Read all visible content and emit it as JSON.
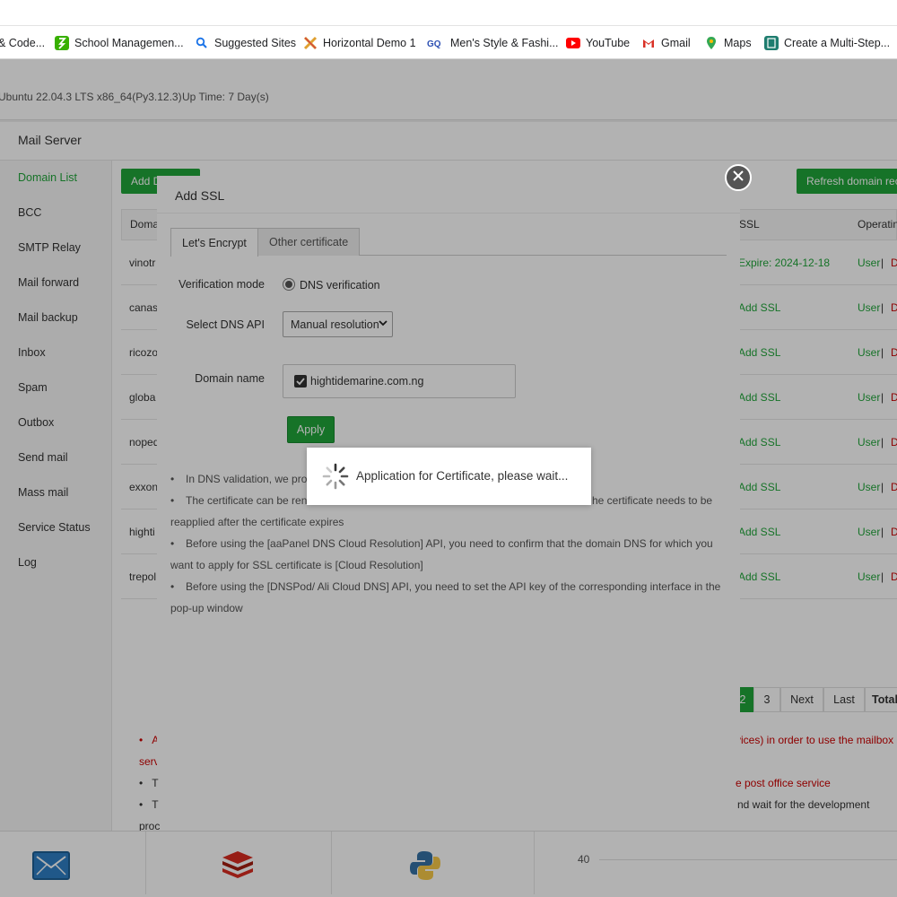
{
  "bookmarks": [
    {
      "label": "& Code...",
      "icon": "code-icon"
    },
    {
      "label": "School Managemen...",
      "icon": "school-icon"
    },
    {
      "label": "Suggested Sites",
      "icon": "search-icon"
    },
    {
      "label": "Horizontal Demo 1",
      "icon": "horizontal-demo-icon"
    },
    {
      "label": "Men's Style & Fashi...",
      "icon": "gq-icon"
    },
    {
      "label": "YouTube",
      "icon": "youtube-icon"
    },
    {
      "label": "Gmail",
      "icon": "gmail-icon"
    },
    {
      "label": "Maps",
      "icon": "maps-icon"
    },
    {
      "label": "Create a Multi-Step...",
      "icon": "page-icon"
    }
  ],
  "sysinfo": {
    "os": "Ubuntu 22.04.3 LTS x86_64(Py3.12.3)",
    "uptime": "Up Time: 7 Day(s)"
  },
  "panel": {
    "title": "Mail Server",
    "add_domain": "Add D",
    "refresh": "Refresh domain rec"
  },
  "sidebar": {
    "items": [
      "Domain List",
      "BCC",
      "SMTP Relay",
      "Mail forward",
      "Mail backup",
      "Inbox",
      "Spam",
      "Outbox",
      "Send mail",
      "Mass mail",
      "Service Status",
      "Log"
    ]
  },
  "table": {
    "headers": {
      "domain": "Doma",
      "ssl": "SSL",
      "ops": "Operatin"
    },
    "rows": [
      {
        "domain": "vinotr",
        "ssl": "Expire: 2024-12-18",
        "user": "User",
        "sep": "|",
        "del": "D"
      },
      {
        "domain": "canas",
        "ssl": "Add SSL",
        "user": "User",
        "sep": "|",
        "del": "D"
      },
      {
        "domain": "ricozo",
        "ssl": "Add SSL",
        "user": "User",
        "sep": "|",
        "del": "D"
      },
      {
        "domain": "globa",
        "ssl": "Add SSL",
        "user": "User",
        "sep": "|",
        "del": "D"
      },
      {
        "domain": "noped",
        "ssl": "Add SSL",
        "user": "User",
        "sep": "|",
        "del": "D"
      },
      {
        "domain": "exxon",
        "ssl": "Add SSL",
        "user": "User",
        "sep": "|",
        "del": "D"
      },
      {
        "domain": "highti",
        "ssl": "Add SSL",
        "user": "User",
        "sep": "|",
        "del": "D"
      },
      {
        "domain": "trepol",
        "ssl": "Add SSL",
        "user": "User",
        "sep": "|",
        "del": "D"
      }
    ]
  },
  "pager": {
    "current": "2",
    "p3": "3",
    "next": "Next",
    "last": "Last",
    "total": "Total"
  },
  "notes": {
    "n1_left": "A",
    "n1_right": "rvices) in order to use the mailbox",
    "n1_wrap": "serv",
    "n2_left": "T",
    "n2_right": "e post office service",
    "n3_left": "T",
    "n3_right": "nd wait for the development",
    "n3_wrap": "proc"
  },
  "chart_tick": "40",
  "modal": {
    "title": "Add SSL",
    "tabs": [
      "Let's Encrypt",
      "Other certificate"
    ],
    "verification_label": "Verification mode",
    "verification_value": "DNS verification",
    "dns_api_label": "Select DNS API",
    "dns_api_value": "Manual resolution",
    "domain_label": "Domain name",
    "domain_value": "hightidemarine.com.ng",
    "apply": "Apply",
    "help": {
      "h1": "In DNS validation, we pro",
      "h2a": "The certificate can be ren",
      "h2b": "he certificate needs to be",
      "h2c": "reapplied after the certificate expires",
      "h3": "Before using the [aaPanel DNS Cloud Resolution] API, you need to confirm that the domain DNS for which you want to apply for SSL certificate is [Cloud Resolution]",
      "h4": "Before using the [DNSPod/ Ali Cloud DNS] API, you need to set the API key of the corresponding interface in the pop-up window"
    }
  },
  "loading": {
    "text": "Application for Certificate, please wait..."
  }
}
